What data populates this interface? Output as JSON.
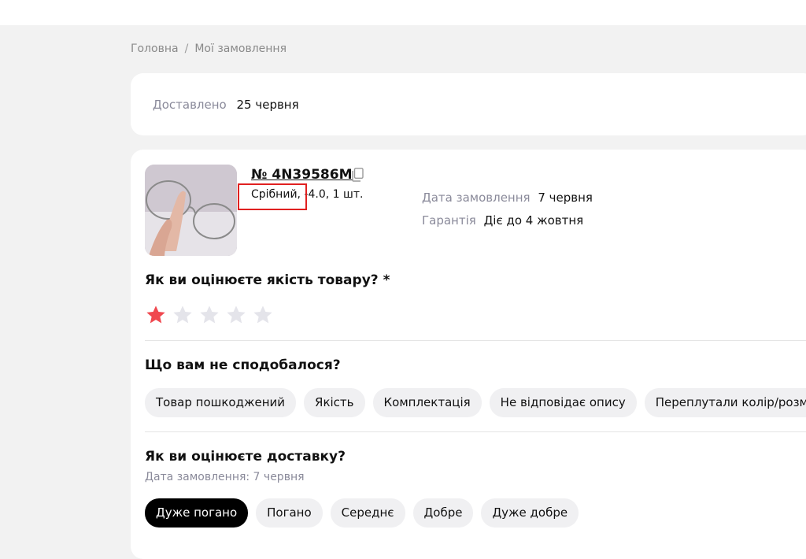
{
  "breadcrumb": {
    "home": "Головна",
    "separator": "/",
    "current": "Мої замовлення"
  },
  "status": {
    "label": "Доставлено",
    "date": "25 червня"
  },
  "order": {
    "number": "№ 4N39586M",
    "variant_color": "Срібний,",
    "variant_rest": " -4.0, 1 шт.",
    "order_date_label": "Дата замовлення",
    "order_date_value": "7 червня",
    "warranty_label": "Гарантія",
    "warranty_value": "Діє до 4 жовтня"
  },
  "quality": {
    "question": "Як ви оцінюєте якість товару? *",
    "rating": 1,
    "max_rating": 5,
    "active_color": "#f0484f",
    "inactive_color": "#e4e4ea"
  },
  "dislikes": {
    "question": "Що вам не сподобалося?",
    "options": [
      "Товар пошкоджений",
      "Якість",
      "Комплектація",
      "Не відповідає опису",
      "Переплутали колір/розмір"
    ]
  },
  "delivery": {
    "question": "Як ви оцінюєте доставку?",
    "subtitle": "Дата замовлення: 7 червня",
    "options": [
      "Дуже погано",
      "Погано",
      "Середнє",
      "Добре",
      "Дуже добре"
    ],
    "selected": 0
  }
}
